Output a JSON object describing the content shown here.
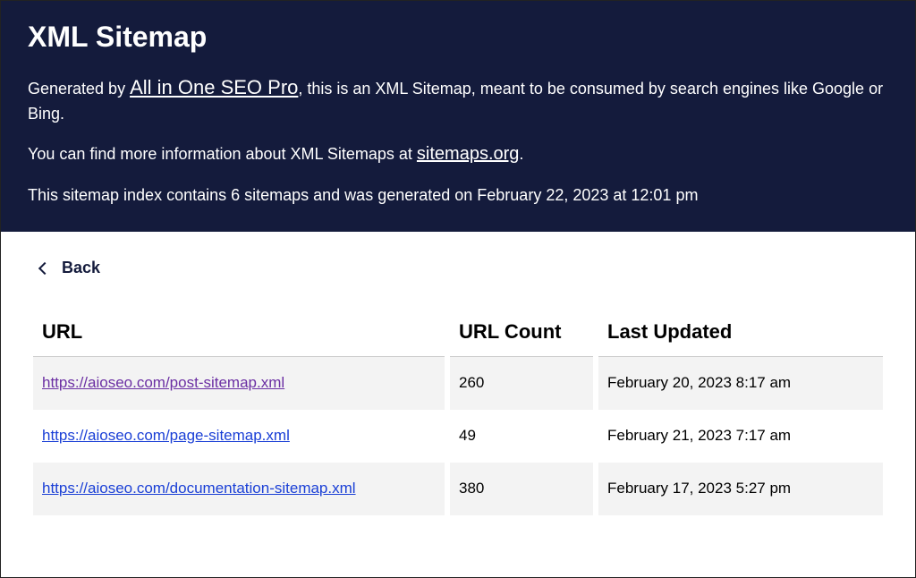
{
  "header": {
    "title": "XML Sitemap",
    "line1_prefix": "Generated by ",
    "line1_link": "All in One SEO Pro",
    "line1_suffix": ", this is an XML Sitemap, meant to be consumed by search engines like Google or Bing.",
    "line2_prefix": "You can find more information about XML Sitemaps at ",
    "line2_link": "sitemaps.org",
    "line2_suffix": ".",
    "line3": "This sitemap index contains 6 sitemaps and was generated on February 22, 2023 at 12:01 pm"
  },
  "back_label": "Back",
  "table": {
    "columns": {
      "url": "URL",
      "count": "URL Count",
      "updated": "Last Updated"
    },
    "rows": [
      {
        "url": "https://aioseo.com/post-sitemap.xml",
        "visited": true,
        "count": "260",
        "updated": "February 20, 2023 8:17 am"
      },
      {
        "url": "https://aioseo.com/page-sitemap.xml",
        "visited": false,
        "count": "49",
        "updated": "February 21, 2023 7:17 am"
      },
      {
        "url": "https://aioseo.com/documentation-sitemap.xml",
        "visited": false,
        "count": "380",
        "updated": "February 17, 2023 5:27 pm"
      }
    ]
  }
}
